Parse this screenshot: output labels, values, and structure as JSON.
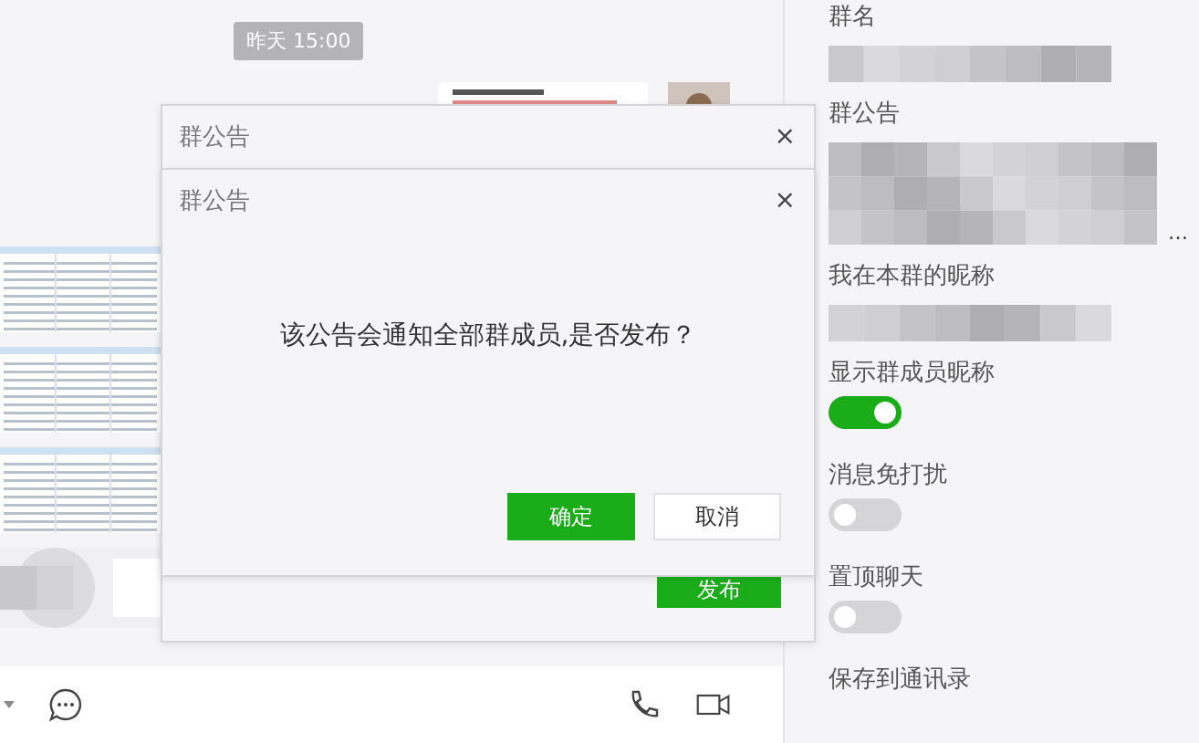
{
  "chat": {
    "timestamp": "昨天 15:00",
    "messages": [
      {
        "kind": "card-with-avatar"
      },
      {
        "kind": "sheet"
      },
      {
        "kind": "sheet"
      },
      {
        "kind": "sheet"
      },
      {
        "kind": "blurred"
      }
    ]
  },
  "toolbar": {
    "left_icons": [
      {
        "kind": "caret"
      },
      {
        "kind": "chat"
      }
    ],
    "right_icons": [
      {
        "kind": "phone"
      },
      {
        "kind": "video"
      }
    ]
  },
  "outer_dialog": {
    "title": "群公告",
    "close": "×",
    "publish_button": "发布"
  },
  "confirm_dialog": {
    "title": "群公告",
    "close": "×",
    "message": "该公告会通知全部群成员,是否发布？",
    "buttons": [
      {
        "label": "确定",
        "kind": "primary"
      },
      {
        "label": "取消",
        "kind": "secondary"
      }
    ]
  },
  "settings": [
    {
      "label": "群名",
      "kind": "redacted-short"
    },
    {
      "label": "群公告",
      "kind": "redacted-long",
      "suffix": "…"
    },
    {
      "label": "我在本群的昵称",
      "kind": "redacted-short"
    },
    {
      "label": "显示群成员昵称",
      "kind": "toggle",
      "on": true
    },
    {
      "label": "消息免打扰",
      "kind": "toggle",
      "on": false
    },
    {
      "label": "置顶聊天",
      "kind": "toggle",
      "on": false
    },
    {
      "label": "保存到通讯录",
      "kind": "label"
    }
  ]
}
